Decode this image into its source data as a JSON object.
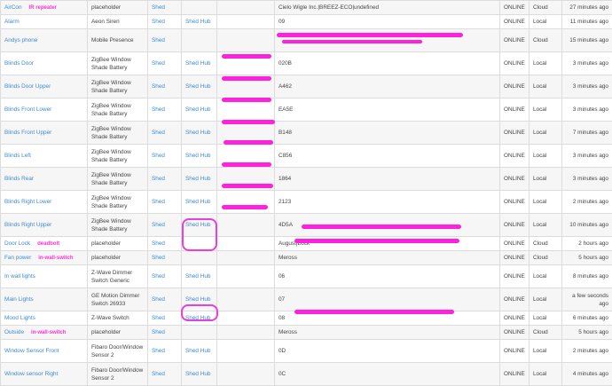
{
  "table": {
    "rows": [
      {
        "name": "AirCon",
        "annotation": "IR repeater",
        "type": "placeholder",
        "location": "Shed",
        "hub": "",
        "info": "Cielo Wigle Inc.|BREEZ-ECO|undefined",
        "status": "ONLINE",
        "conn": "Cloud",
        "time": "27 minutes ago"
      },
      {
        "name": "Alarm",
        "annotation": "",
        "type": "Aeon Siren",
        "location": "Shed",
        "hub": "Shed Hub",
        "info": "09",
        "status": "ONLINE",
        "conn": "Local",
        "time": "11 minutes ago"
      },
      {
        "name": "Andys phone",
        "annotation": "",
        "type": "Mobile Presence",
        "location": "Shed",
        "hub": "",
        "info": "",
        "status": "ONLINE",
        "conn": "Cloud",
        "time": "15 minutes ago"
      },
      {
        "name": "Blinds Door",
        "annotation": "",
        "type": "ZigBee Window Shade Battery",
        "location": "Shed",
        "hub": "Shed Hub",
        "info": "020B",
        "status": "ONLINE",
        "conn": "Local",
        "time": "3 minutes ago"
      },
      {
        "name": "Blinds Door Upper",
        "annotation": "",
        "type": "ZigBee Window Shade Battery",
        "location": "Shed",
        "hub": "Shed Hub",
        "info": "A462",
        "status": "ONLINE",
        "conn": "Local",
        "time": "3 minutes ago"
      },
      {
        "name": "Blinds Front Lower",
        "annotation": "",
        "type": "ZigBee Window Shade Battery",
        "location": "Shed",
        "hub": "Shed Hub",
        "info": "EA5E",
        "status": "ONLINE",
        "conn": "Local",
        "time": "3 minutes ago"
      },
      {
        "name": "Blinds Front Upper",
        "annotation": "",
        "type": "ZigBee Window Shade Battery",
        "location": "Shed",
        "hub": "Shed Hub",
        "info": "B148",
        "status": "ONLINE",
        "conn": "Local",
        "time": "7 minutes ago"
      },
      {
        "name": "Blinds Left",
        "annotation": "",
        "type": "ZigBee Window Shade Battery",
        "location": "Shed",
        "hub": "Shed Hub",
        "info": "C856",
        "status": "ONLINE",
        "conn": "Local",
        "time": "3 minutes ago"
      },
      {
        "name": "Blinds Rear",
        "annotation": "",
        "type": "ZigBee Window Shade Battery",
        "location": "Shed",
        "hub": "Shed Hub",
        "info": "1864",
        "status": "ONLINE",
        "conn": "Local",
        "time": "3 minutes ago"
      },
      {
        "name": "Blinds Right Lower",
        "annotation": "",
        "type": "ZigBee Window Shade Battery",
        "location": "Shed",
        "hub": "Shed Hub",
        "info": "2123",
        "status": "ONLINE",
        "conn": "Local",
        "time": "2 minutes ago"
      },
      {
        "name": "Blinds Right Upper",
        "annotation": "",
        "type": "ZigBee Window Shade Battery",
        "location": "Shed",
        "hub": "Shed Hub",
        "info": "4D5A",
        "status": "ONLINE",
        "conn": "Local",
        "time": "10 minutes ago"
      },
      {
        "name": "Door Lock",
        "annotation": "deadbolt",
        "type": "placeholder",
        "location": "Shed",
        "hub": "",
        "info": "August|Lock",
        "status": "ONLINE",
        "conn": "Cloud",
        "time": "2 hours ago"
      },
      {
        "name": "Fan power",
        "annotation": "in-wall-switch",
        "type": "placeholder",
        "location": "Shed",
        "hub": "",
        "info": "Meross",
        "status": "ONLINE",
        "conn": "Cloud",
        "time": "5 hours ago"
      },
      {
        "name": "In wall lights",
        "annotation": "",
        "type": "Z-Wave Dimmer Switch Generic",
        "location": "Shed",
        "hub": "Shed Hub",
        "info": "06",
        "status": "ONLINE",
        "conn": "Local",
        "time": "8 minutes ago"
      },
      {
        "name": "Main Lights",
        "annotation": "",
        "type": "GE Motion Dimmer Switch 26933",
        "location": "Shed",
        "hub": "Shed Hub",
        "info": "07",
        "status": "ONLINE",
        "conn": "Local",
        "time": "a few seconds ago"
      },
      {
        "name": "Mood Lights",
        "annotation": "",
        "type": "Z-Wave Switch",
        "location": "Shed",
        "hub": "Shed Hub",
        "info": "08",
        "status": "ONLINE",
        "conn": "Local",
        "time": "6 minutes ago"
      },
      {
        "name": "Outside",
        "annotation": "in-wall-switch",
        "type": "placeholder",
        "location": "Shed",
        "hub": "",
        "info": "Meross",
        "status": "ONLINE",
        "conn": "Cloud",
        "time": "5 hours ago"
      },
      {
        "name": "Window Sensor Front",
        "annotation": "",
        "type": "Fibaro Door/Window Sensor 2",
        "location": "Shed",
        "hub": "Shed Hub",
        "info": "0D",
        "status": "ONLINE",
        "conn": "Local",
        "time": "2 minutes ago"
      },
      {
        "name": "Window sensor Right",
        "annotation": "",
        "type": "Fibaro Door/Window Sensor 2",
        "location": "Shed",
        "hub": "Shed Hub",
        "info": "0C",
        "status": "ONLINE",
        "conn": "Local",
        "time": "4 minutes ago"
      }
    ]
  },
  "colors": {
    "link": "#3d8bd0",
    "annotation": "#ff2fd0"
  }
}
